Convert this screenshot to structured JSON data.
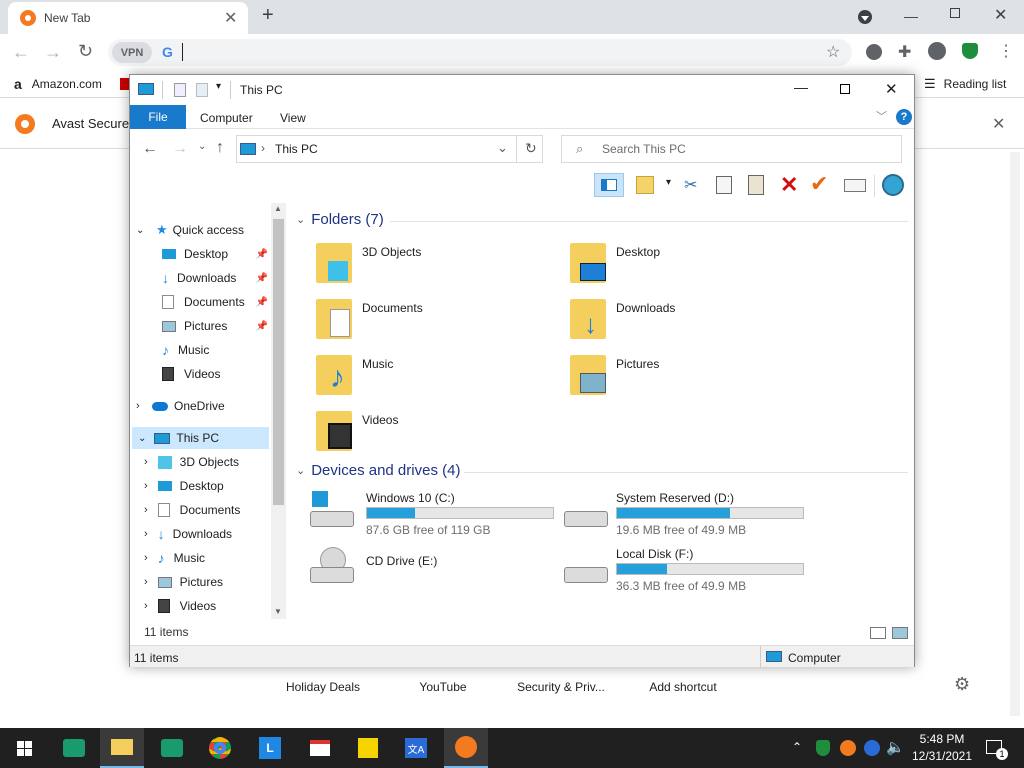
{
  "browser": {
    "tab_title": "New Tab",
    "omnibox_value": "",
    "vpn_label": "VPN",
    "bookmarks": [
      {
        "label": "Amazon.com"
      }
    ],
    "reading_list": "Reading list",
    "infobar_text": "Avast Secure",
    "shortcuts": [
      "Holiday Deals",
      "YouTube",
      "Security & Priv...",
      "Add shortcut"
    ]
  },
  "explorer": {
    "title": "This PC",
    "ribbon_tabs": [
      "File",
      "Computer",
      "View"
    ],
    "address": "This PC",
    "search_placeholder": "Search This PC",
    "nav": {
      "quick_access": "Quick access",
      "quick_items": [
        "Desktop",
        "Downloads",
        "Documents",
        "Pictures",
        "Music",
        "Videos"
      ],
      "onedrive": "OneDrive",
      "this_pc": "This PC",
      "pc_items": [
        "3D Objects",
        "Desktop",
        "Documents",
        "Downloads",
        "Music",
        "Pictures",
        "Videos"
      ],
      "items_count": "11 items"
    },
    "folders_header": "Folders (7)",
    "folders": [
      "3D Objects",
      "Desktop",
      "Documents",
      "Downloads",
      "Music",
      "Pictures",
      "Videos"
    ],
    "drives_header": "Devices and drives (4)",
    "drives": [
      {
        "name": "Windows 10 (C:)",
        "free": "87.6 GB free of 119 GB",
        "used_fraction": 0.26
      },
      {
        "name": "System Reserved (D:)",
        "free": "19.6 MB free of 49.9 MB",
        "used_fraction": 0.61
      },
      {
        "name": "CD Drive (E:)",
        "free": "",
        "used_fraction": null
      },
      {
        "name": "Local Disk (F:)",
        "free": "36.3 MB free of 49.9 MB",
        "used_fraction": 0.27
      }
    ],
    "status_items": "11 items",
    "status_location": "Computer"
  },
  "taskbar": {
    "time": "5:48 PM",
    "date": "12/31/2021",
    "notif_count": "1"
  }
}
